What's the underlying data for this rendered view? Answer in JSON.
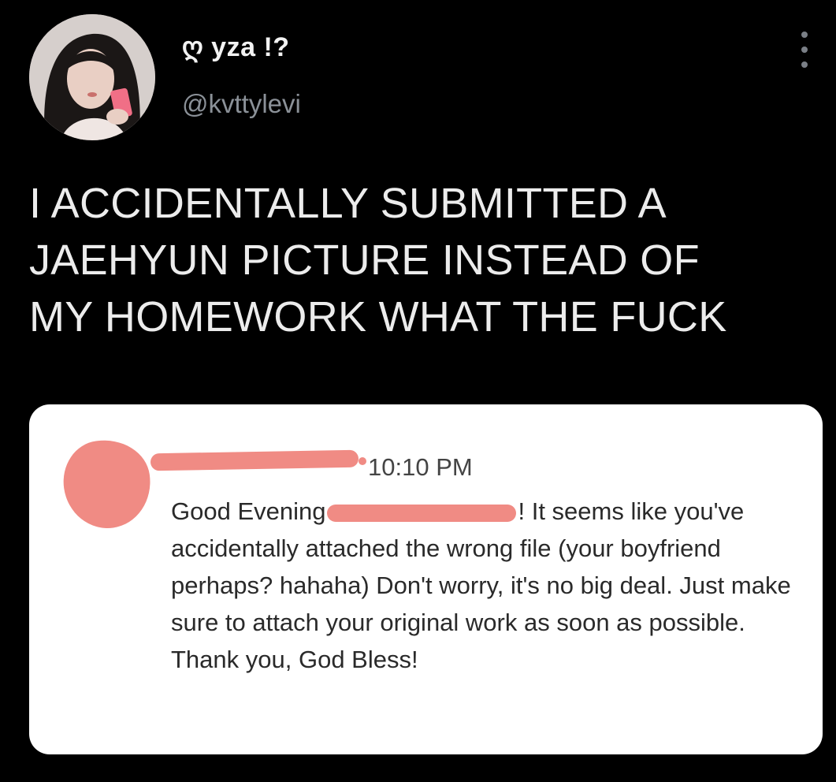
{
  "tweet": {
    "display_name": "ღ yza !?",
    "handle": "@kvttylevi",
    "avatar_icon": "profile-photo",
    "more_icon": "vertical-ellipsis",
    "text": "I ACCIDENTALLY SUBMITTED A\nJAEHYUN PICTURE INSTEAD OF\nMY HOMEWORK WHAT THE FUCK"
  },
  "media": {
    "timestamp": "10:10 PM",
    "message_before_redaction": "Good Evening",
    "message_after_redaction": "! It seems like you've accidentally attached the wrong file (your boyfriend perhaps? hahaha) Don't worry, it's no big deal. Just make sure to attach your original work as soon as possible. Thank you, God Bless!",
    "redaction_color": "#f08b84"
  },
  "colors": {
    "background": "#000000",
    "text_primary": "#e7e9ea",
    "text_secondary": "#8b9198",
    "card_background": "#ffffff"
  }
}
